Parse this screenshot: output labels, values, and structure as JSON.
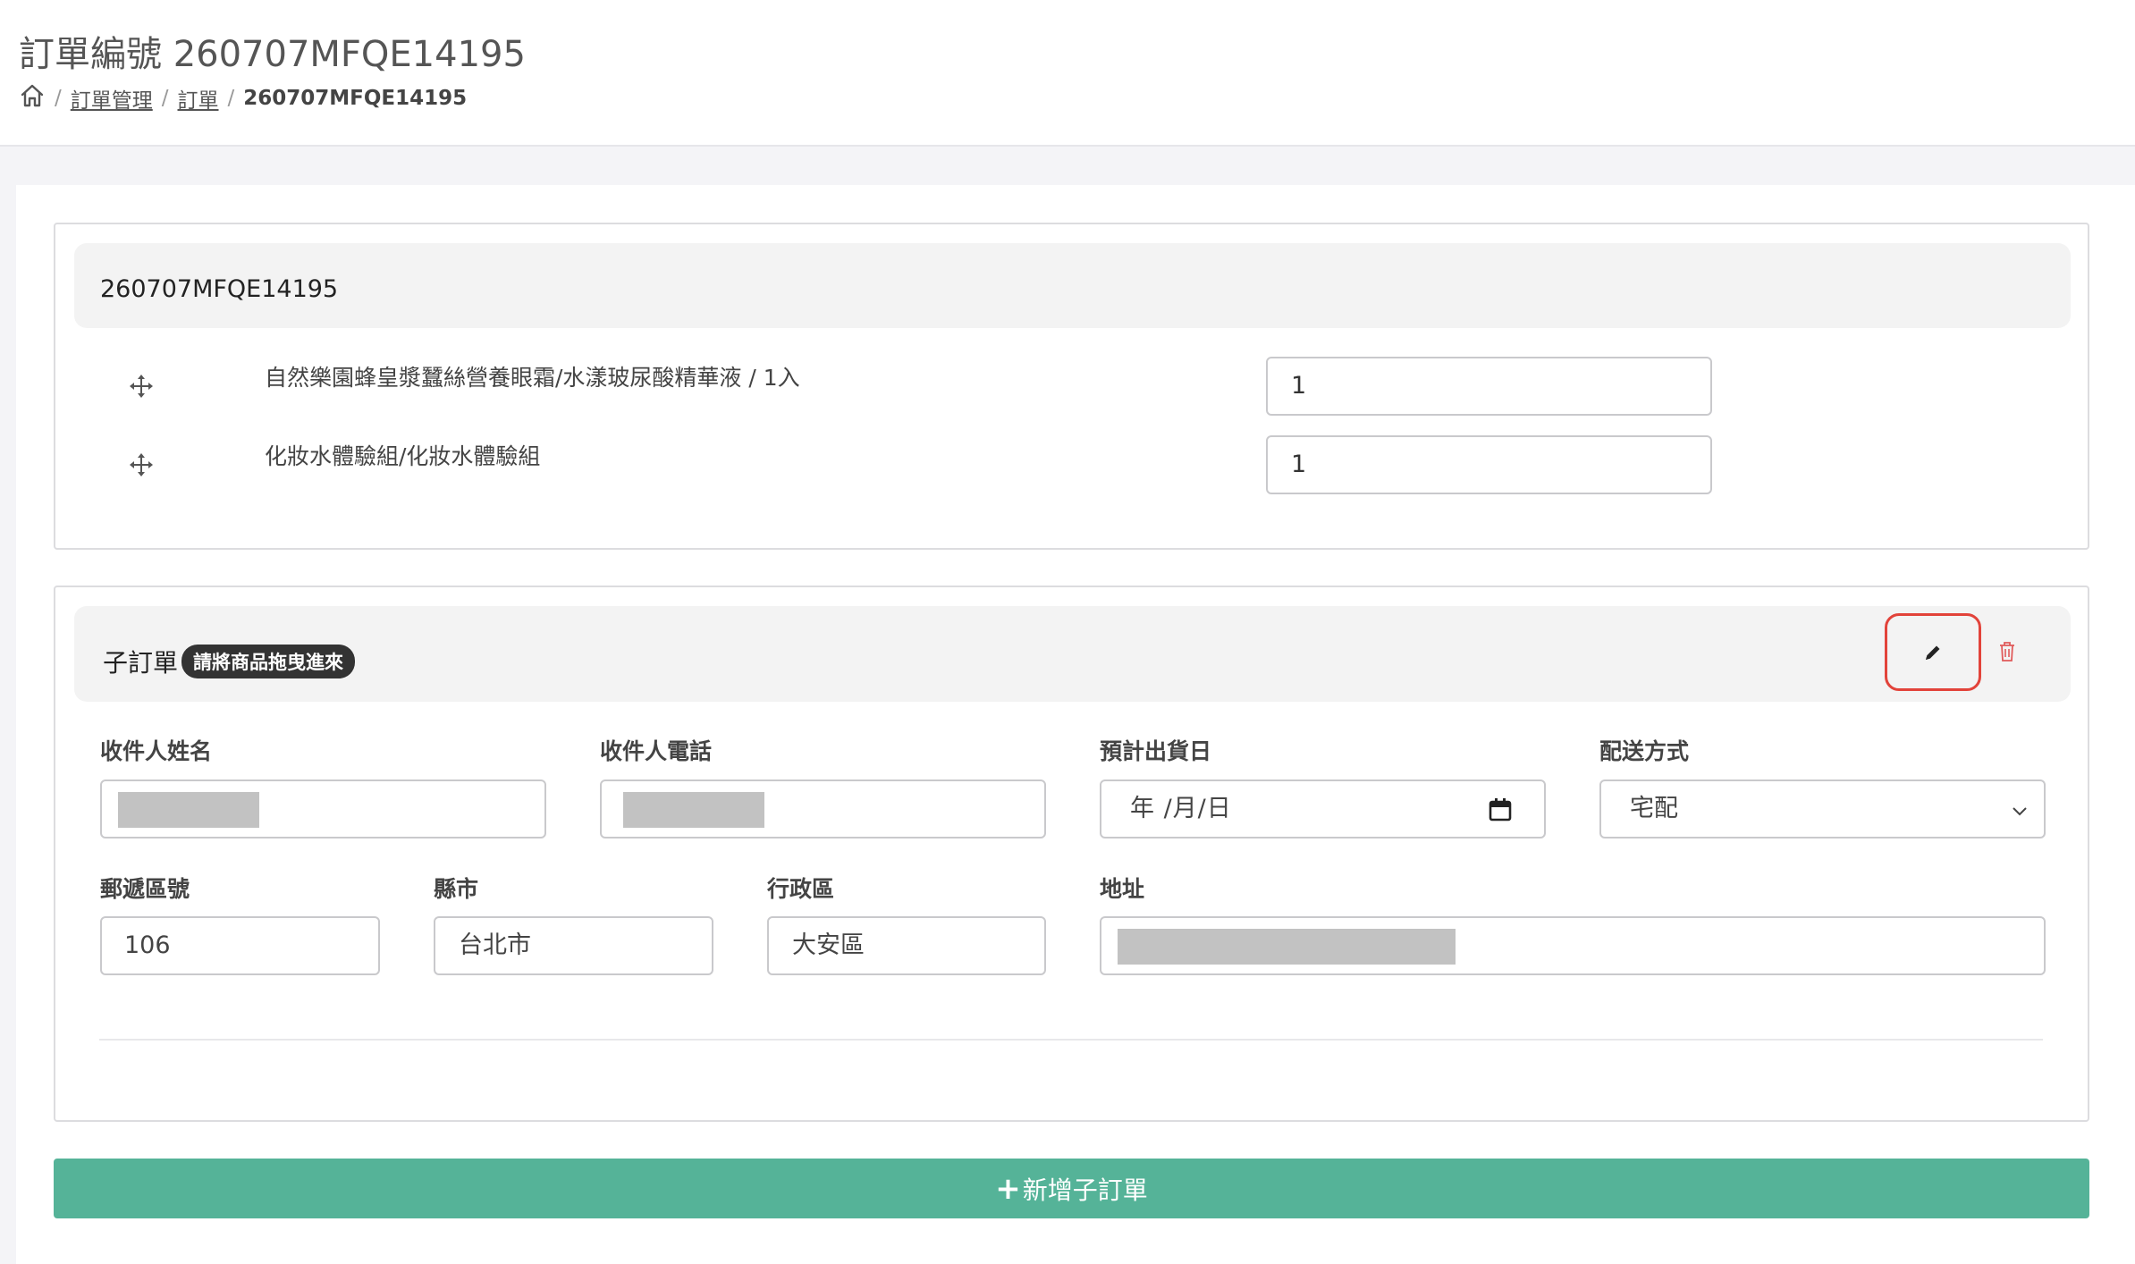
{
  "header": {
    "title": "訂單編號 260707MFQE14195",
    "breadcrumb": {
      "home_icon": "home-icon",
      "items": [
        "訂單管理",
        "訂單"
      ],
      "current": "260707MFQE14195"
    }
  },
  "order_panel": {
    "order_id": "260707MFQE14195",
    "items": [
      {
        "name": "自然樂園蜂皇漿蠶絲營養眼霜/水漾玻尿酸精華液 / 1入",
        "qty": "1",
        "icon": "move-icon"
      },
      {
        "name": "化妝水體驗組/化妝水體驗組",
        "qty": "1",
        "icon": "move-icon"
      }
    ]
  },
  "sub_order": {
    "title": "子訂單",
    "badge": "請將商品拖曳進來",
    "edit_icon": "pencil-icon",
    "delete_icon": "trash-icon",
    "fields": {
      "recipient_name": {
        "label": "收件人姓名",
        "value": ""
      },
      "recipient_phone": {
        "label": "收件人電話",
        "value": ""
      },
      "ship_date": {
        "label": "預計出貨日",
        "value": "年 /月/日"
      },
      "delivery_method": {
        "label": "配送方式",
        "value": "宅配"
      },
      "zip": {
        "label": "郵遞區號",
        "value": "106"
      },
      "city": {
        "label": "縣市",
        "value": "台北市"
      },
      "district": {
        "label": "行政區",
        "value": "大安區"
      },
      "address": {
        "label": "地址",
        "value": ""
      }
    }
  },
  "actions": {
    "add_sub_order_label": "新增子訂單"
  },
  "colors": {
    "accent_green": "#55b398",
    "highlight_red": "#e2433a",
    "badge_dark": "#333333"
  }
}
